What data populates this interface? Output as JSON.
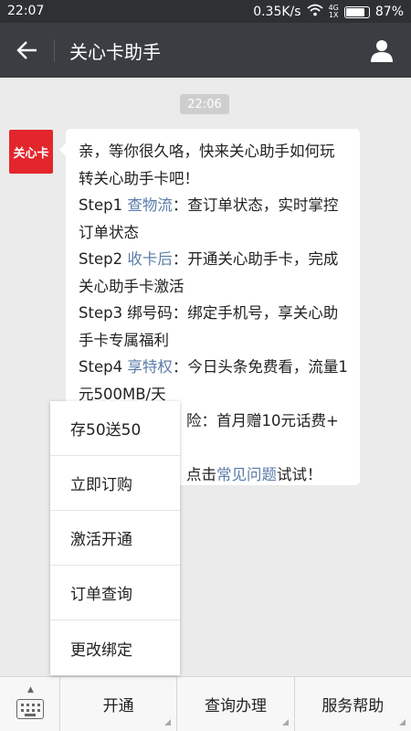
{
  "status_bar": {
    "time": "22:07",
    "network_speed": "0.35K/s",
    "signal_label": "4G",
    "signal_label2": "1X",
    "battery_percent": "87%",
    "battery_level": 0.87
  },
  "header": {
    "title": "关心卡助手"
  },
  "chat": {
    "timestamp": "22:06",
    "avatar_label": "关心卡",
    "message": {
      "intro": "亲，等你很久咯，快来关心助手如何玩转关心助手卡吧！",
      "step1_prefix": "Step1 ",
      "step1_link": "查物流",
      "step1_text": "：查订单状态，实时掌控订单状态",
      "step2_prefix": "Step2 ",
      "step2_link": "收卡后",
      "step2_text": "：开通关心助手卡，完成关心助手卡激活",
      "step3_text": "Step3 绑号码：绑定手机号，享关心助手卡专属福利",
      "step4_prefix": "Step4 ",
      "step4_link": "享特权",
      "step4_text": "：今日头条免费看，流量1元500MB/天",
      "step5_visible": "险：首月赠10元话费+",
      "footer_prefix": "点击",
      "footer_link": "常见问题",
      "footer_suffix": "试试！"
    }
  },
  "popup_menu": {
    "items": [
      "存50送50",
      "立即订购",
      "激活开通",
      "订单查询",
      "更改绑定"
    ]
  },
  "bottom_menu": {
    "items": [
      "开通",
      "查询办理",
      "服务帮助"
    ]
  },
  "colors": {
    "status_bar": "#2d3133",
    "header": "#3a3e42",
    "chat_background": "#ebebeb",
    "link": "#5b7ca8",
    "avatar": "#e3262c"
  },
  "icons": {
    "back": "back-arrow-icon",
    "profile": "person-icon",
    "wifi": "wifi-icon",
    "keyboard": "keyboard-icon"
  }
}
